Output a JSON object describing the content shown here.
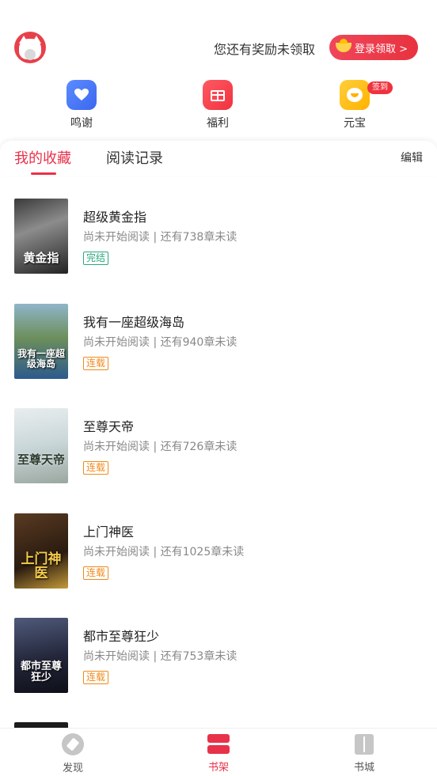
{
  "header": {
    "reward_text": "您还有奖励未领取",
    "login_button": "登录领取 >"
  },
  "quick_actions": [
    {
      "label": "鸣谢",
      "icon": "heart-icon"
    },
    {
      "label": "福利",
      "icon": "gift-icon"
    },
    {
      "label": "元宝",
      "icon": "ingot-icon",
      "badge": "签到"
    }
  ],
  "tabs": {
    "favorites": "我的收藏",
    "history": "阅读记录",
    "edit": "编辑"
  },
  "books": [
    {
      "title": "超级黄金指",
      "cover_text": "黄金指",
      "progress": "尚未开始阅读 | 还有738章未读",
      "status": "完结"
    },
    {
      "title": "我有一座超级海岛",
      "cover_text": "我有一座超级海岛",
      "progress": "尚未开始阅读 | 还有940章未读",
      "status": "连载"
    },
    {
      "title": "至尊天帝",
      "cover_text": "至尊天帝",
      "progress": "尚未开始阅读 | 还有726章未读",
      "status": "连载"
    },
    {
      "title": "上门神医",
      "cover_text": "上门神医",
      "progress": "尚未开始阅读 | 还有1025章未读",
      "status": "连载"
    },
    {
      "title": "都市至尊狂少",
      "cover_text": "都市至尊狂少",
      "progress": "尚未开始阅读 | 还有753章未读",
      "status": "连载"
    }
  ],
  "bottom_nav": [
    {
      "label": "发现",
      "icon": "compass-icon",
      "active": false
    },
    {
      "label": "书架",
      "icon": "bookshelf-icon",
      "active": true
    },
    {
      "label": "书城",
      "icon": "book-icon",
      "active": false
    }
  ],
  "colors": {
    "accent": "#e8324a",
    "completed_tag": "#2aa87a",
    "ongoing_tag": "#f08a1c"
  }
}
